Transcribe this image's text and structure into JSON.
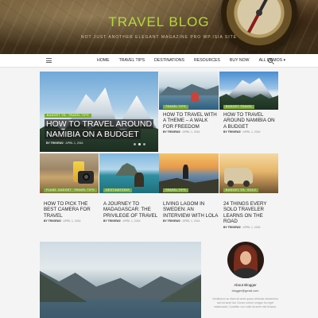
{
  "header": {
    "title": "TRAVEL BLOG",
    "tagline": "NOT JUST ANOTHER ELEGANT MAGAZINE PRO WP.ISIA SITE"
  },
  "nav": {
    "items": [
      "HOME",
      "TRAVEL TIPS",
      "DESTINATIONS",
      "RESOURCES",
      "BUY NOW",
      "ALL DEMOS"
    ]
  },
  "posts": [
    {
      "badges": [
        "BUDGET TRAVEL",
        "TRAVEL TIPS"
      ],
      "title": "HOW TO TRAVEL AROUND NAMIBIA ON A BUDGET",
      "author": "BY TRIVIEW2",
      "date": "APRIL 1, 2016"
    },
    {
      "badges": [
        "TRAVEL TIPS"
      ],
      "title": "HOW TO TRAVEL WITH A THEME – A WALK FOR FREEDOM",
      "author": "BY TRIVIEW2",
      "date": "APRIL 1, 2016"
    },
    {
      "badges": [
        "BUDGET TRAVEL"
      ],
      "title": "HOW TO TRAVEL AROUND NAMIBIA ON A BUDGET",
      "author": "BY TRIVIEW2",
      "date": "APRIL 1, 2016"
    },
    {
      "badges": [
        "PLANET",
        "GADGETS",
        "TRAVEL TIPS"
      ],
      "title": "HOW TO PICK THE BEST CAMERA FOR TRAVEL",
      "author": "BY TRIVIEW2",
      "date": "APRIL 1, 2016"
    },
    {
      "badges": [
        "DESTINATIONS"
      ],
      "title": "A JOURNEY TO MADAGASCAR: THE PRIVILEGE OF TRAVEL",
      "author": "BY TRIVIEW2",
      "date": "APRIL 1, 2016"
    },
    {
      "badges": [
        "TRAVEL TIPS"
      ],
      "title": "LIVING LAGOM IN SWEDEN: AN INTERVIEW WITH LOLA",
      "author": "BY TRIVIEW2",
      "date": "APRIL 1, 2016"
    },
    {
      "badges": [
        "BUDGET TRAVEL",
        "SOLO"
      ],
      "title": "24 THINGS EVERY SOLO TRAVELER LEARNS ON THE ROAD",
      "author": "BY TRIVIEW2",
      "date": "APRIL 1, 2016"
    }
  ],
  "sidebar": {
    "title": "About Blogger",
    "name": "blogger@gmail.com",
    "text": "Vestibulum ac diam sit amet quam vehicula elementum sed sit amet dui. Donec rutrum congue leo eget malesuada. Curabitur non nulla sit amet nisl tempus."
  },
  "colors": {
    "accent": "#b4d83a",
    "badge": "#7cae2f"
  }
}
